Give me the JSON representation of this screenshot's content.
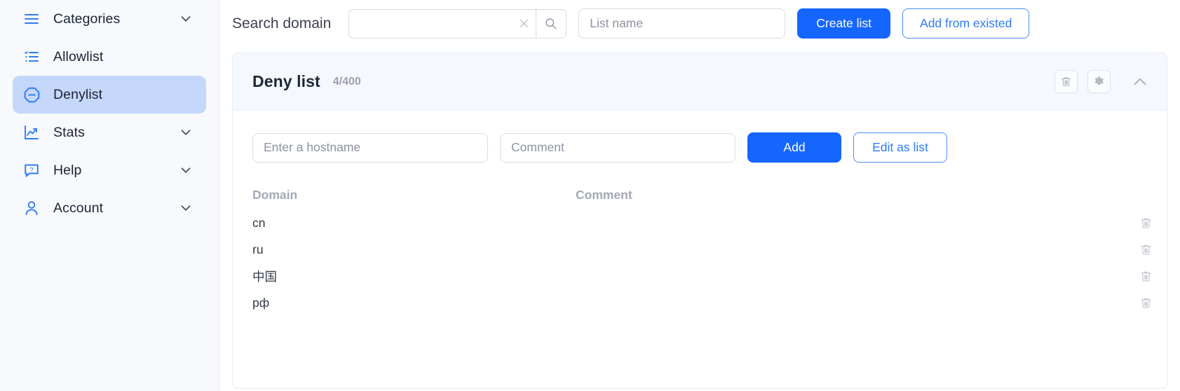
{
  "sidebar": {
    "items": [
      {
        "label": "Categories",
        "icon": "menu-icon",
        "chevron": true,
        "active": false
      },
      {
        "label": "Allowlist",
        "icon": "checklist-icon",
        "chevron": false,
        "active": false
      },
      {
        "label": "Denylist",
        "icon": "block-icon",
        "chevron": false,
        "active": true
      },
      {
        "label": "Stats",
        "icon": "chart-line-icon",
        "chevron": true,
        "active": false
      },
      {
        "label": "Help",
        "icon": "help-bubble-icon",
        "chevron": true,
        "active": false
      },
      {
        "label": "Account",
        "icon": "user-icon",
        "chevron": true,
        "active": false
      }
    ]
  },
  "toolbar": {
    "search_label": "Search domain",
    "search_value": "",
    "search_placeholder": "",
    "clear_icon": "close-icon",
    "search_icon": "search-icon",
    "list_name_value": "",
    "list_name_placeholder": "List name",
    "create_list_label": "Create list",
    "add_from_existed_label": "Add from existed"
  },
  "panel": {
    "title": "Deny list",
    "count": "4/400",
    "delete_icon": "trash-icon",
    "settings_icon": "gear-icon",
    "collapse_icon": "chevron-up-icon",
    "form": {
      "hostname_value": "",
      "hostname_placeholder": "Enter a hostname",
      "comment_value": "",
      "comment_placeholder": "Comment",
      "add_label": "Add",
      "edit_as_list_label": "Edit as list"
    },
    "table": {
      "headers": {
        "domain": "Domain",
        "comment": "Comment"
      },
      "row_delete_icon": "trash-icon",
      "rows": [
        {
          "domain": "cn",
          "comment": ""
        },
        {
          "domain": "ru",
          "comment": ""
        },
        {
          "domain": "中国",
          "comment": ""
        },
        {
          "domain": "рф",
          "comment": ""
        }
      ]
    }
  },
  "colors": {
    "accent": "#1565ff",
    "accent_link": "#2f7cf6",
    "sidebar_bg": "#f7f9fd",
    "active_item_bg": "#c5d7fb",
    "panel_head_bg": "#f5f8fe",
    "muted_text": "#a3a9b4"
  }
}
